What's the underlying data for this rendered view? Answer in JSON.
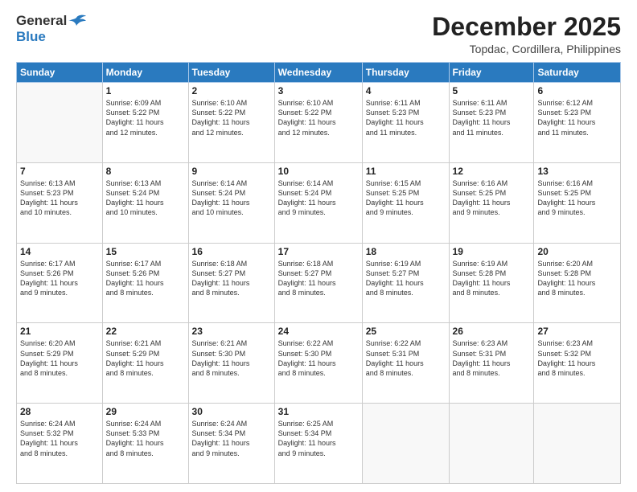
{
  "header": {
    "logo_line1": "General",
    "logo_line2": "Blue",
    "month_title": "December 2025",
    "subtitle": "Topdac, Cordillera, Philippines"
  },
  "weekdays": [
    "Sunday",
    "Monday",
    "Tuesday",
    "Wednesday",
    "Thursday",
    "Friday",
    "Saturday"
  ],
  "weeks": [
    [
      {
        "day": "",
        "info": ""
      },
      {
        "day": "1",
        "info": "Sunrise: 6:09 AM\nSunset: 5:22 PM\nDaylight: 11 hours\nand 12 minutes."
      },
      {
        "day": "2",
        "info": "Sunrise: 6:10 AM\nSunset: 5:22 PM\nDaylight: 11 hours\nand 12 minutes."
      },
      {
        "day": "3",
        "info": "Sunrise: 6:10 AM\nSunset: 5:22 PM\nDaylight: 11 hours\nand 12 minutes."
      },
      {
        "day": "4",
        "info": "Sunrise: 6:11 AM\nSunset: 5:23 PM\nDaylight: 11 hours\nand 11 minutes."
      },
      {
        "day": "5",
        "info": "Sunrise: 6:11 AM\nSunset: 5:23 PM\nDaylight: 11 hours\nand 11 minutes."
      },
      {
        "day": "6",
        "info": "Sunrise: 6:12 AM\nSunset: 5:23 PM\nDaylight: 11 hours\nand 11 minutes."
      }
    ],
    [
      {
        "day": "7",
        "info": "Sunrise: 6:13 AM\nSunset: 5:23 PM\nDaylight: 11 hours\nand 10 minutes."
      },
      {
        "day": "8",
        "info": "Sunrise: 6:13 AM\nSunset: 5:24 PM\nDaylight: 11 hours\nand 10 minutes."
      },
      {
        "day": "9",
        "info": "Sunrise: 6:14 AM\nSunset: 5:24 PM\nDaylight: 11 hours\nand 10 minutes."
      },
      {
        "day": "10",
        "info": "Sunrise: 6:14 AM\nSunset: 5:24 PM\nDaylight: 11 hours\nand 9 minutes."
      },
      {
        "day": "11",
        "info": "Sunrise: 6:15 AM\nSunset: 5:25 PM\nDaylight: 11 hours\nand 9 minutes."
      },
      {
        "day": "12",
        "info": "Sunrise: 6:16 AM\nSunset: 5:25 PM\nDaylight: 11 hours\nand 9 minutes."
      },
      {
        "day": "13",
        "info": "Sunrise: 6:16 AM\nSunset: 5:25 PM\nDaylight: 11 hours\nand 9 minutes."
      }
    ],
    [
      {
        "day": "14",
        "info": "Sunrise: 6:17 AM\nSunset: 5:26 PM\nDaylight: 11 hours\nand 9 minutes."
      },
      {
        "day": "15",
        "info": "Sunrise: 6:17 AM\nSunset: 5:26 PM\nDaylight: 11 hours\nand 8 minutes."
      },
      {
        "day": "16",
        "info": "Sunrise: 6:18 AM\nSunset: 5:27 PM\nDaylight: 11 hours\nand 8 minutes."
      },
      {
        "day": "17",
        "info": "Sunrise: 6:18 AM\nSunset: 5:27 PM\nDaylight: 11 hours\nand 8 minutes."
      },
      {
        "day": "18",
        "info": "Sunrise: 6:19 AM\nSunset: 5:27 PM\nDaylight: 11 hours\nand 8 minutes."
      },
      {
        "day": "19",
        "info": "Sunrise: 6:19 AM\nSunset: 5:28 PM\nDaylight: 11 hours\nand 8 minutes."
      },
      {
        "day": "20",
        "info": "Sunrise: 6:20 AM\nSunset: 5:28 PM\nDaylight: 11 hours\nand 8 minutes."
      }
    ],
    [
      {
        "day": "21",
        "info": "Sunrise: 6:20 AM\nSunset: 5:29 PM\nDaylight: 11 hours\nand 8 minutes."
      },
      {
        "day": "22",
        "info": "Sunrise: 6:21 AM\nSunset: 5:29 PM\nDaylight: 11 hours\nand 8 minutes."
      },
      {
        "day": "23",
        "info": "Sunrise: 6:21 AM\nSunset: 5:30 PM\nDaylight: 11 hours\nand 8 minutes."
      },
      {
        "day": "24",
        "info": "Sunrise: 6:22 AM\nSunset: 5:30 PM\nDaylight: 11 hours\nand 8 minutes."
      },
      {
        "day": "25",
        "info": "Sunrise: 6:22 AM\nSunset: 5:31 PM\nDaylight: 11 hours\nand 8 minutes."
      },
      {
        "day": "26",
        "info": "Sunrise: 6:23 AM\nSunset: 5:31 PM\nDaylight: 11 hours\nand 8 minutes."
      },
      {
        "day": "27",
        "info": "Sunrise: 6:23 AM\nSunset: 5:32 PM\nDaylight: 11 hours\nand 8 minutes."
      }
    ],
    [
      {
        "day": "28",
        "info": "Sunrise: 6:24 AM\nSunset: 5:32 PM\nDaylight: 11 hours\nand 8 minutes."
      },
      {
        "day": "29",
        "info": "Sunrise: 6:24 AM\nSunset: 5:33 PM\nDaylight: 11 hours\nand 8 minutes."
      },
      {
        "day": "30",
        "info": "Sunrise: 6:24 AM\nSunset: 5:34 PM\nDaylight: 11 hours\nand 9 minutes."
      },
      {
        "day": "31",
        "info": "Sunrise: 6:25 AM\nSunset: 5:34 PM\nDaylight: 11 hours\nand 9 minutes."
      },
      {
        "day": "",
        "info": ""
      },
      {
        "day": "",
        "info": ""
      },
      {
        "day": "",
        "info": ""
      }
    ]
  ]
}
